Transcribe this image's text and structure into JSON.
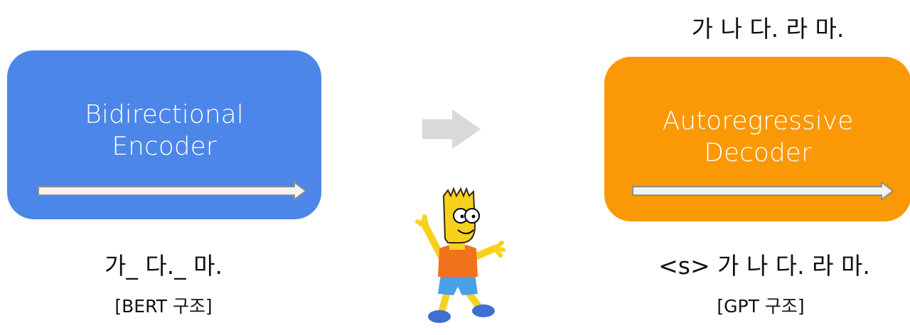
{
  "encoder": {
    "title_line1": "Bidirectional",
    "title_line2": "Encoder",
    "caption": "가_ 다._ 마.",
    "label": "[BERT 구조]",
    "color": "#4c86e8"
  },
  "decoder": {
    "output_caption": "가 나 다. 라 마.",
    "title_line1": "Autoregressive",
    "title_line2": "Decoder",
    "caption": "<s> 가 나 다. 라 마.",
    "label": "[GPT 구조]",
    "color": "#fa9806"
  },
  "icons": {
    "transition": "right-arrow-icon",
    "character": "bart-simpson-figure"
  }
}
